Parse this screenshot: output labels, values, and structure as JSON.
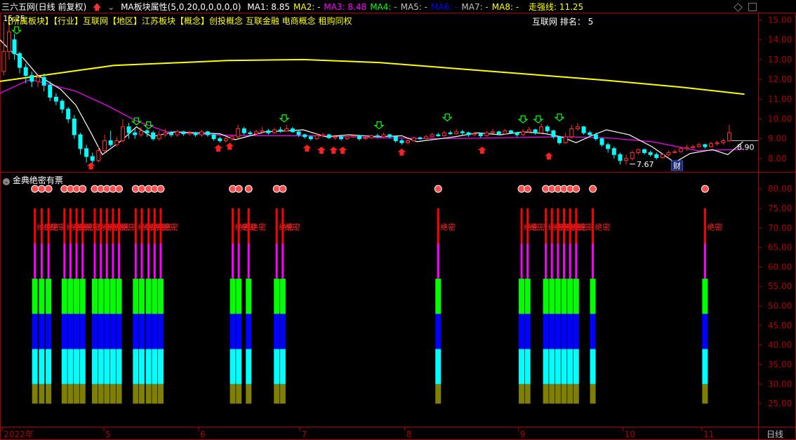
{
  "header": {
    "security": "三六五网(日线 前复权)",
    "indicator": "MA板块属性(5,0,20,0,0,0,0,0)",
    "ma": [
      {
        "label": "MA1:",
        "value": "8.85",
        "color": "#ffffff"
      },
      {
        "label": "MA2:",
        "value": "-",
        "color": "#ffff00"
      },
      {
        "label": "MA3:",
        "value": "8.48",
        "color": "#ff00ff"
      },
      {
        "label": "MA4:",
        "value": "-",
        "color": "#00ff00"
      },
      {
        "label": "MA5:",
        "value": "-",
        "color": "#c0c0c0"
      },
      {
        "label": "MA6:",
        "value": "-",
        "color": "#0000ff"
      },
      {
        "label": "MA7:",
        "value": "-",
        "color": "#c0c0c0"
      },
      {
        "label": "MA8:",
        "value": "-",
        "color": "#ffff00"
      }
    ],
    "strong_line": "走强线: 11.25"
  },
  "tags": "【所属板块】【行业】互联网【地区】江苏板块【概念】创投概念 互联金融 电商概念 租购同权",
  "rank": "互联网 排名： 5",
  "indicator_title": "金典绝密有票",
  "price_axis": {
    "ticks": [
      "15.00",
      "14.00",
      "13.00",
      "12.00",
      "11.00",
      "10.00",
      "9.00",
      "8.00"
    ],
    "min": 7.5,
    "max": 15.3
  },
  "indicator_axis": {
    "ticks": [
      "80.00",
      "75.00",
      "70.00",
      "65.00",
      "60.00",
      "55.00",
      "50.00",
      "45.00",
      "40.00",
      "35.00",
      "30.00",
      "25.00"
    ],
    "min": 20,
    "max": 82
  },
  "x_axis": {
    "labels": [
      {
        "text": "2022年",
        "pos": 0.003
      },
      {
        "text": "5",
        "pos": 0.137
      },
      {
        "text": "6",
        "pos": 0.262
      },
      {
        "text": "7",
        "pos": 0.396
      },
      {
        "text": "8",
        "pos": 0.534
      },
      {
        "text": "9",
        "pos": 0.684
      },
      {
        "text": "10",
        "pos": 0.822
      },
      {
        "text": "11",
        "pos": 0.926
      }
    ],
    "period": "日线"
  },
  "price_labels": {
    "high": "15.25",
    "low": "7.67",
    "last": "8.90",
    "fin_badge": "财"
  },
  "chart_data": {
    "type": "candlestick",
    "ma1_color": "#ffffff",
    "ma3_color": "#ff00ff",
    "strong_color": "#ffff00",
    "indicator_label": "绝密",
    "strong_line": [
      [
        0,
        11.9
      ],
      [
        0.15,
        12.7
      ],
      [
        0.3,
        12.95
      ],
      [
        0.4,
        13.0
      ],
      [
        0.5,
        12.85
      ],
      [
        0.6,
        12.55
      ],
      [
        0.7,
        12.25
      ],
      [
        0.8,
        11.95
      ],
      [
        0.9,
        11.6
      ],
      [
        0.982,
        11.25
      ]
    ],
    "ma3_line": [
      [
        0,
        11.3
      ],
      [
        0.04,
        12.0
      ],
      [
        0.1,
        11.4
      ],
      [
        0.14,
        10.7
      ],
      [
        0.18,
        9.9
      ],
      [
        0.22,
        9.35
      ],
      [
        0.28,
        9.2
      ],
      [
        0.35,
        9.15
      ],
      [
        0.42,
        9.15
      ],
      [
        0.5,
        9.05
      ],
      [
        0.58,
        9.0
      ],
      [
        0.66,
        9.05
      ],
      [
        0.74,
        9.1
      ],
      [
        0.8,
        9.05
      ],
      [
        0.86,
        8.85
      ],
      [
        0.92,
        8.4
      ],
      [
        0.97,
        8.45
      ],
      [
        0.982,
        8.48
      ]
    ],
    "ma1_line": [
      [
        0,
        14.0
      ],
      [
        0.015,
        13.4
      ],
      [
        0.03,
        13.1
      ],
      [
        0.05,
        12.2
      ],
      [
        0.08,
        11.5
      ],
      [
        0.1,
        10.7
      ],
      [
        0.12,
        9.3
      ],
      [
        0.135,
        8.2
      ],
      [
        0.16,
        8.9
      ],
      [
        0.18,
        9.6
      ],
      [
        0.2,
        9.1
      ],
      [
        0.23,
        9.35
      ],
      [
        0.26,
        9.3
      ],
      [
        0.29,
        9.25
      ],
      [
        0.31,
        8.95
      ],
      [
        0.33,
        9.15
      ],
      [
        0.35,
        9.35
      ],
      [
        0.38,
        9.4
      ],
      [
        0.4,
        9.45
      ],
      [
        0.43,
        9.1
      ],
      [
        0.46,
        9.2
      ],
      [
        0.5,
        9.1
      ],
      [
        0.53,
        9.15
      ],
      [
        0.55,
        8.85
      ],
      [
        0.58,
        9.0
      ],
      [
        0.6,
        9.1
      ],
      [
        0.63,
        9.3
      ],
      [
        0.66,
        9.2
      ],
      [
        0.69,
        9.35
      ],
      [
        0.72,
        9.25
      ],
      [
        0.74,
        9.1
      ],
      [
        0.76,
        8.8
      ],
      [
        0.78,
        9.15
      ],
      [
        0.8,
        9.45
      ],
      [
        0.83,
        9.2
      ],
      [
        0.86,
        8.6
      ],
      [
        0.89,
        7.8
      ],
      [
        0.91,
        8.25
      ],
      [
        0.94,
        8.45
      ],
      [
        0.96,
        8.2
      ],
      [
        0.98,
        8.85
      ]
    ],
    "candles": [
      [
        0.005,
        12.4,
        13.4,
        14.9,
        12.2
      ],
      [
        0.012,
        13.4,
        14.4,
        15.25,
        13.0
      ],
      [
        0.019,
        14.0,
        13.3,
        14.3,
        13.0
      ],
      [
        0.026,
        13.3,
        12.6,
        13.4,
        12.3
      ],
      [
        0.034,
        12.6,
        12.2,
        12.8,
        11.8
      ],
      [
        0.042,
        12.2,
        11.9,
        12.4,
        11.6
      ],
      [
        0.05,
        11.9,
        12.1,
        12.3,
        11.6
      ],
      [
        0.058,
        12.1,
        11.7,
        12.3,
        11.4
      ],
      [
        0.066,
        11.7,
        11.1,
        11.9,
        10.9
      ],
      [
        0.074,
        11.1,
        10.9,
        11.3,
        10.7
      ],
      [
        0.082,
        10.9,
        10.5,
        11.0,
        10.3
      ],
      [
        0.09,
        10.5,
        10.0,
        10.6,
        9.8
      ],
      [
        0.098,
        10.0,
        9.2,
        10.2,
        9.0
      ],
      [
        0.106,
        9.2,
        8.5,
        9.3,
        8.2
      ],
      [
        0.114,
        8.5,
        8.1,
        8.7,
        7.8
      ],
      [
        0.122,
        8.1,
        7.9,
        8.3,
        7.7
      ],
      [
        0.13,
        7.9,
        8.4,
        8.6,
        7.8
      ],
      [
        0.138,
        8.4,
        8.9,
        9.2,
        8.3
      ],
      [
        0.146,
        8.9,
        8.7,
        9.4,
        8.6
      ],
      [
        0.154,
        8.7,
        8.9,
        9.1,
        8.6
      ],
      [
        0.162,
        8.9,
        9.6,
        10.0,
        8.8
      ],
      [
        0.17,
        9.6,
        9.3,
        9.8,
        9.0
      ],
      [
        0.178,
        9.3,
        9.2,
        9.5,
        9.0
      ],
      [
        0.186,
        9.2,
        9.4,
        9.6,
        9.1
      ],
      [
        0.194,
        9.4,
        9.3,
        9.5,
        9.1
      ],
      [
        0.202,
        9.3,
        9.0,
        9.4,
        8.9
      ],
      [
        0.21,
        9.0,
        9.2,
        9.4,
        8.9
      ],
      [
        0.218,
        9.2,
        9.3,
        9.5,
        9.1
      ],
      [
        0.226,
        9.3,
        9.2,
        9.4,
        9.1
      ],
      [
        0.234,
        9.2,
        9.35,
        9.45,
        9.1
      ],
      [
        0.242,
        9.35,
        9.25,
        9.4,
        9.15
      ],
      [
        0.25,
        9.25,
        9.3,
        9.4,
        9.15
      ],
      [
        0.258,
        9.3,
        9.2,
        9.35,
        9.1
      ],
      [
        0.266,
        9.2,
        9.35,
        9.45,
        9.1
      ],
      [
        0.274,
        9.35,
        9.2,
        9.4,
        9.1
      ],
      [
        0.282,
        9.2,
        9.0,
        9.25,
        8.9
      ],
      [
        0.29,
        9.0,
        8.9,
        9.1,
        8.8
      ],
      [
        0.298,
        8.9,
        9.0,
        9.1,
        8.8
      ],
      [
        0.306,
        9.0,
        9.1,
        9.2,
        8.9
      ],
      [
        0.314,
        9.1,
        9.5,
        9.7,
        9.0
      ],
      [
        0.322,
        9.5,
        9.3,
        9.6,
        9.2
      ],
      [
        0.33,
        9.3,
        9.25,
        9.4,
        9.15
      ],
      [
        0.338,
        9.25,
        9.35,
        9.45,
        9.2
      ],
      [
        0.346,
        9.35,
        9.4,
        9.6,
        9.3
      ],
      [
        0.354,
        9.4,
        9.3,
        9.5,
        9.2
      ],
      [
        0.362,
        9.3,
        9.45,
        9.55,
        9.25
      ],
      [
        0.37,
        9.45,
        9.4,
        9.6,
        9.3
      ],
      [
        0.378,
        9.4,
        9.5,
        9.7,
        9.35
      ],
      [
        0.386,
        9.5,
        9.35,
        9.6,
        9.3
      ],
      [
        0.394,
        9.35,
        9.2,
        9.4,
        9.1
      ],
      [
        0.402,
        9.2,
        9.1,
        9.25,
        9.0
      ],
      [
        0.41,
        9.1,
        9.0,
        9.15,
        8.9
      ],
      [
        0.418,
        9.0,
        9.15,
        9.25,
        8.95
      ],
      [
        0.426,
        9.15,
        9.2,
        9.3,
        9.05
      ],
      [
        0.434,
        9.2,
        9.05,
        9.25,
        9.0
      ],
      [
        0.442,
        9.05,
        9.1,
        9.2,
        8.95
      ],
      [
        0.45,
        9.1,
        9.0,
        9.15,
        8.9
      ],
      [
        0.458,
        9.0,
        9.1,
        9.2,
        8.95
      ],
      [
        0.466,
        9.1,
        9.15,
        9.25,
        9.05
      ],
      [
        0.474,
        9.15,
        9.0,
        9.2,
        8.9
      ],
      [
        0.482,
        9.0,
        9.05,
        9.15,
        8.95
      ],
      [
        0.49,
        9.05,
        9.15,
        9.2,
        9.0
      ],
      [
        0.498,
        9.15,
        9.1,
        9.25,
        9.05
      ],
      [
        0.506,
        9.1,
        9.2,
        9.3,
        9.05
      ],
      [
        0.514,
        9.2,
        9.1,
        9.25,
        9.0
      ],
      [
        0.522,
        9.1,
        8.9,
        9.15,
        8.8
      ],
      [
        0.53,
        8.9,
        8.8,
        9.0,
        8.7
      ],
      [
        0.538,
        8.8,
        8.9,
        9.0,
        8.7
      ],
      [
        0.546,
        8.9,
        9.05,
        9.1,
        8.85
      ],
      [
        0.554,
        9.05,
        9.0,
        9.1,
        8.95
      ],
      [
        0.562,
        9.0,
        9.1,
        9.2,
        8.95
      ],
      [
        0.57,
        9.1,
        9.2,
        9.3,
        9.05
      ],
      [
        0.578,
        9.2,
        9.15,
        9.3,
        9.1
      ],
      [
        0.586,
        9.15,
        9.3,
        9.4,
        9.1
      ],
      [
        0.594,
        9.3,
        9.25,
        9.4,
        9.2
      ],
      [
        0.602,
        9.25,
        9.35,
        9.5,
        9.2
      ],
      [
        0.61,
        9.35,
        9.3,
        9.45,
        9.2
      ],
      [
        0.618,
        9.3,
        9.2,
        9.35,
        9.1
      ],
      [
        0.626,
        9.2,
        9.25,
        9.35,
        9.15
      ],
      [
        0.634,
        9.25,
        9.15,
        9.3,
        9.05
      ],
      [
        0.642,
        9.15,
        9.3,
        9.4,
        9.1
      ],
      [
        0.65,
        9.3,
        9.35,
        9.5,
        9.25
      ],
      [
        0.658,
        9.35,
        9.25,
        9.4,
        9.2
      ],
      [
        0.666,
        9.25,
        9.4,
        9.5,
        9.2
      ],
      [
        0.674,
        9.4,
        9.3,
        9.45,
        9.25
      ],
      [
        0.682,
        9.3,
        9.2,
        9.35,
        9.1
      ],
      [
        0.69,
        9.2,
        9.35,
        9.5,
        9.15
      ],
      [
        0.698,
        9.35,
        9.45,
        9.6,
        9.3
      ],
      [
        0.706,
        9.45,
        9.3,
        9.5,
        9.2
      ],
      [
        0.714,
        9.3,
        9.6,
        9.8,
        9.25
      ],
      [
        0.722,
        9.6,
        9.4,
        9.7,
        9.3
      ],
      [
        0.73,
        9.4,
        9.1,
        9.45,
        9.0
      ],
      [
        0.738,
        9.1,
        8.8,
        9.15,
        8.7
      ],
      [
        0.746,
        8.8,
        9.1,
        9.3,
        8.75
      ],
      [
        0.754,
        9.1,
        9.5,
        9.7,
        9.0
      ],
      [
        0.762,
        9.5,
        9.6,
        9.8,
        9.4
      ],
      [
        0.77,
        9.6,
        9.3,
        9.65,
        9.2
      ],
      [
        0.778,
        9.3,
        9.2,
        9.4,
        9.1
      ],
      [
        0.786,
        9.2,
        9.0,
        9.3,
        8.9
      ],
      [
        0.794,
        9.0,
        8.7,
        9.05,
        8.6
      ],
      [
        0.802,
        8.7,
        8.5,
        8.8,
        8.3
      ],
      [
        0.81,
        8.5,
        8.2,
        8.6,
        8.0
      ],
      [
        0.818,
        8.2,
        7.9,
        8.3,
        7.7
      ],
      [
        0.826,
        7.9,
        8.0,
        8.2,
        7.7
      ],
      [
        0.834,
        8.0,
        8.3,
        8.4,
        7.9
      ],
      [
        0.842,
        8.3,
        8.45,
        8.5,
        8.2
      ],
      [
        0.85,
        8.45,
        8.3,
        8.5,
        8.2
      ],
      [
        0.858,
        8.3,
        8.2,
        8.4,
        8.1
      ],
      [
        0.866,
        8.2,
        8.05,
        8.3,
        7.95
      ],
      [
        0.874,
        8.05,
        8.2,
        8.3,
        8.0
      ],
      [
        0.882,
        8.2,
        8.3,
        8.4,
        8.1
      ],
      [
        0.89,
        8.3,
        8.35,
        8.45,
        8.25
      ],
      [
        0.898,
        8.35,
        8.5,
        8.6,
        8.3
      ],
      [
        0.906,
        8.5,
        8.55,
        8.7,
        8.4
      ],
      [
        0.914,
        8.55,
        8.6,
        8.7,
        8.5
      ],
      [
        0.922,
        8.6,
        8.7,
        8.8,
        8.55
      ],
      [
        0.93,
        8.7,
        8.6,
        8.75,
        8.5
      ],
      [
        0.938,
        8.6,
        8.75,
        8.85,
        8.55
      ],
      [
        0.946,
        8.75,
        8.8,
        8.9,
        8.65
      ],
      [
        0.954,
        8.8,
        8.9,
        9.0,
        8.7
      ],
      [
        0.962,
        8.9,
        9.3,
        9.7,
        8.85
      ]
    ],
    "down_arrows": [
      [
        0.022,
        14.3
      ],
      [
        0.18,
        9.7
      ],
      [
        0.196,
        9.5
      ],
      [
        0.375,
        9.85
      ],
      [
        0.5,
        9.5
      ],
      [
        0.59,
        9.9
      ],
      [
        0.69,
        9.8
      ],
      [
        0.71,
        9.8
      ],
      [
        0.738,
        9.9
      ]
    ],
    "up_arrows": [
      [
        0.12,
        7.8
      ],
      [
        0.288,
        8.7
      ],
      [
        0.303,
        8.8
      ],
      [
        0.405,
        8.7
      ],
      [
        0.424,
        8.6
      ],
      [
        0.44,
        8.6
      ],
      [
        0.452,
        8.6
      ],
      [
        0.53,
        8.5
      ],
      [
        0.636,
        8.6
      ],
      [
        0.724,
        8.3
      ]
    ],
    "indicator_bars": [
      0.046,
      0.055,
      0.064,
      0.085,
      0.093,
      0.101,
      0.109,
      0.125,
      0.133,
      0.141,
      0.149,
      0.157,
      0.179,
      0.187,
      0.196,
      0.204,
      0.212,
      0.307,
      0.315,
      0.328,
      0.365,
      0.373,
      0.578,
      0.688,
      0.696,
      0.72,
      0.728,
      0.736,
      0.744,
      0.752,
      0.76,
      0.782,
      0.93
    ],
    "bands": [
      {
        "from": 25,
        "to": 30,
        "color": "#808000"
      },
      {
        "from": 30,
        "to": 39,
        "color": "#00ffff"
      },
      {
        "from": 39,
        "to": 48,
        "color": "#0000ff"
      },
      {
        "from": 48,
        "to": 57,
        "color": "#00ff00"
      },
      {
        "from": 57,
        "to": 66,
        "color": "#ff00ff"
      },
      {
        "from": 66,
        "to": 75,
        "color": "#ff0000"
      }
    ]
  }
}
